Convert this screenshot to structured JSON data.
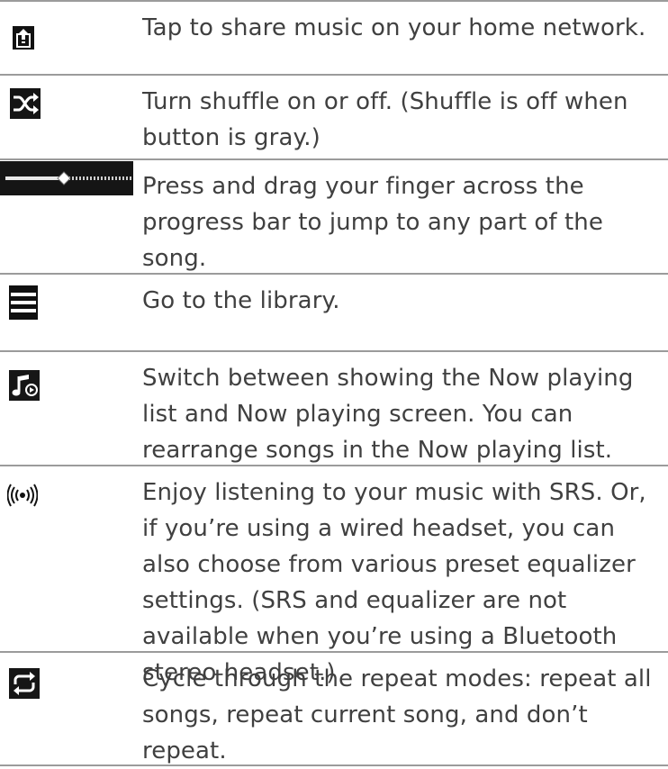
{
  "rows": [
    {
      "icon": "share-network-icon",
      "text": "Tap to share music on your home network."
    },
    {
      "icon": "shuffle-icon",
      "text": "Turn shuffle on or off. (Shuffle is off when button is gray.)"
    },
    {
      "icon": "progress-bar-icon",
      "text": "Press and drag your finger across the progress bar to jump to any part of the song."
    },
    {
      "icon": "library-menu-icon",
      "text": "Go to the library."
    },
    {
      "icon": "now-playing-toggle-icon",
      "text": "Switch between showing the Now playing list and Now playing screen. You can rearrange songs in the Now playing list."
    },
    {
      "icon": "srs-sound-icon",
      "text": "Enjoy listening to your music with SRS. Or, if you’re using a wired headset, you can also choose from various preset equalizer settings. (SRS and equalizer are not available when you’re using a Bluetooth stereo headset.)"
    },
    {
      "icon": "repeat-icon",
      "text": "Cycle through the repeat modes: repeat all songs, repeat current song, and don’t repeat."
    }
  ],
  "colors": {
    "text": "#404040",
    "divider": "#9b9b9b",
    "icon_background": "#111111",
    "icon_foreground": "#ffffff"
  }
}
